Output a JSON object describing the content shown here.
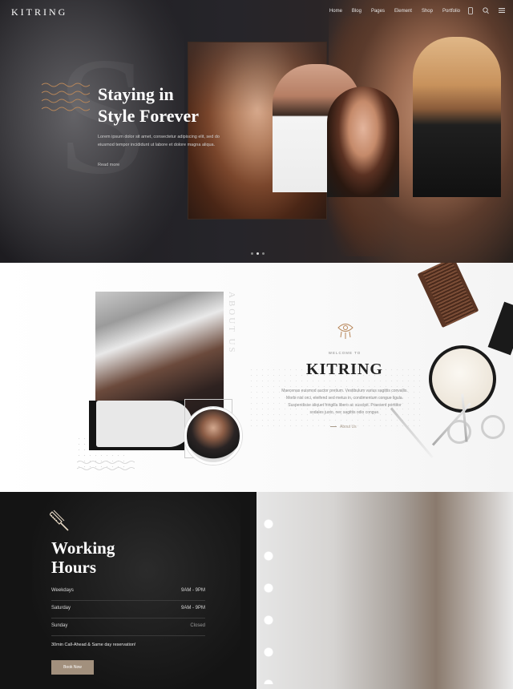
{
  "header": {
    "logo": "KITRING",
    "nav": [
      "Home",
      "Blog",
      "Pages",
      "Element",
      "Shop",
      "Portfolio"
    ],
    "icons": [
      "phone-icon",
      "search-icon",
      "menu-icon"
    ]
  },
  "hero": {
    "title_line1": "Staying in",
    "title_line2": "Style Forever",
    "text": "Lorem ipsum dolor sit amet, consectetur adipiscing elit, sed do eiusmod tempor incididunt ut labore et dolore magna aliqua.",
    "read_more": "Read more",
    "slides": 3,
    "active_slide": 1,
    "big_letter": "S"
  },
  "about": {
    "vertical_label": "ABOUT US",
    "welcome": "WELCOME TO",
    "title": "KITRING",
    "text": "Maecenas euismod auctor pretium. Vestibulum varius sagittis convallis. Morbi nisl orci, eleifend sed metus in, condimentum congue ligula. Suspendisse aliquet fringilla libero ac suscipit. Praesent porttitor sodales justo, nec sagittis odio congue.",
    "link": "About Us",
    "icon": "eye-icon"
  },
  "hours": {
    "title_line1": "Working",
    "title_line2": "Hours",
    "rows": [
      {
        "day": "Weekdays",
        "time": "9AM - 9PM"
      },
      {
        "day": "Saturday",
        "time": "9AM - 9PM"
      },
      {
        "day": "Sunday",
        "time": "Closed"
      }
    ],
    "note": "30min Call-Ahead & Same day reservation!",
    "button": "Book Now",
    "icon": "comb-icon"
  },
  "colors": {
    "accent": "#a2907d",
    "dark": "#141414",
    "wave": "#b8875a"
  }
}
